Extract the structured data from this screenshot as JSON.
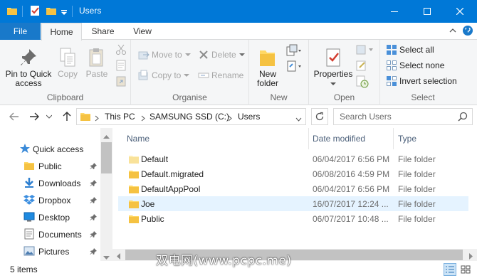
{
  "window": {
    "title": "Users",
    "accent_color": "#0078d7"
  },
  "ribbon_tabs": [
    {
      "label": "File"
    },
    {
      "label": "Home"
    },
    {
      "label": "Share"
    },
    {
      "label": "View"
    }
  ],
  "ribbon": {
    "clipboard": {
      "pin_label": "Pin to Quick\naccess",
      "copy_label": "Copy",
      "paste_label": "Paste",
      "group_label": "Clipboard"
    },
    "organise": {
      "move_to_label": "Move to",
      "copy_to_label": "Copy to",
      "delete_label": "Delete",
      "rename_label": "Rename",
      "group_label": "Organise"
    },
    "new": {
      "new_folder_label": "New\nfolder",
      "group_label": "New"
    },
    "open": {
      "properties_label": "Properties",
      "group_label": "Open"
    },
    "select": {
      "select_all_label": "Select all",
      "select_none_label": "Select none",
      "invert_label": "Invert selection",
      "group_label": "Select"
    }
  },
  "address": {
    "crumbs": [
      "This PC",
      "SAMSUNG SSD (C:)",
      "Users"
    ],
    "search_placeholder": "Search Users"
  },
  "nav_pane": {
    "items": [
      {
        "label": "Quick access",
        "icon": "star-icon"
      },
      {
        "label": "Public",
        "icon": "folder-icon"
      },
      {
        "label": "Downloads",
        "icon": "download-arrow-icon"
      },
      {
        "label": "Dropbox",
        "icon": "dropbox-icon"
      },
      {
        "label": "Desktop",
        "icon": "desktop-icon"
      },
      {
        "label": "Documents",
        "icon": "documents-icon"
      },
      {
        "label": "Pictures",
        "icon": "pictures-icon"
      }
    ]
  },
  "file_list": {
    "columns": [
      "Name",
      "Date modified",
      "Type"
    ],
    "rows": [
      {
        "name": "Default",
        "date": "06/04/2017 6:56 PM",
        "type": "File folder"
      },
      {
        "name": "Default.migrated",
        "date": "06/08/2016 4:59 PM",
        "type": "File folder"
      },
      {
        "name": "DefaultAppPool",
        "date": "06/04/2017 6:56 PM",
        "type": "File folder"
      },
      {
        "name": "Joe",
        "date": "16/07/2017 12:24 ...",
        "type": "File folder"
      },
      {
        "name": "Public",
        "date": "06/07/2017 10:48 ...",
        "type": "File folder"
      }
    ],
    "selected_row": 3
  },
  "status": {
    "item_count": "5 items"
  },
  "watermark": "双电网(www.pcpc.me)"
}
